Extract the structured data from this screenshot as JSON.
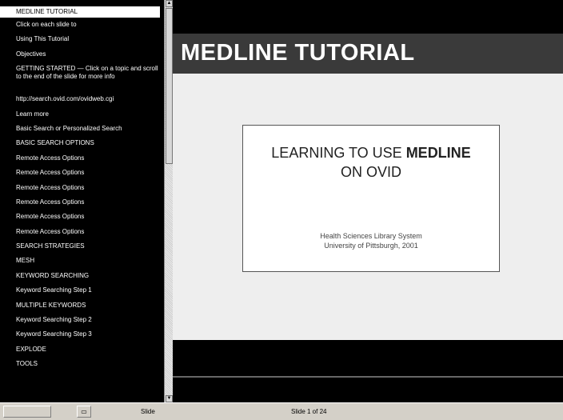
{
  "outline": {
    "items": [
      {
        "label": "MEDLINE TUTORIAL",
        "selected": true
      },
      {
        "label": "Click on each slide to"
      },
      {
        "label": "Using This Tutorial"
      },
      {
        "label": "Objectives"
      },
      {
        "label": "GETTING STARTED — Click on a topic and scroll to the end of the slide for more info",
        "multi": true
      },
      {
        "label": "http://search.ovid.com/ovidweb.cgi"
      },
      {
        "label": "Learn more"
      },
      {
        "label": "Basic Search or Personalized Search"
      },
      {
        "label": "BASIC SEARCH OPTIONS"
      },
      {
        "label": "Remote Access Options"
      },
      {
        "label": "Remote Access Options"
      },
      {
        "label": "Remote Access Options"
      },
      {
        "label": "Remote Access Options"
      },
      {
        "label": "Remote Access Options"
      },
      {
        "label": "Remote Access Options"
      },
      {
        "label": "SEARCH STRATEGIES"
      },
      {
        "label": "MESH"
      },
      {
        "label": "KEYWORD SEARCHING"
      },
      {
        "label": "Keyword Searching Step 1"
      },
      {
        "label": "MULTIPLE KEYWORDS"
      },
      {
        "label": "Keyword Searching Step 2"
      },
      {
        "label": "Keyword Searching Step 3"
      },
      {
        "label": "EXPLODE"
      },
      {
        "label": "TOOLS"
      }
    ]
  },
  "slide": {
    "title": "MEDLINE TUTORIAL",
    "heading_prefix": "LEARNING TO USE ",
    "heading_bold": "MEDLINE",
    "heading_line2": "ON OVID",
    "sub_line1": "Health Sciences Library System",
    "sub_line2": "University of Pittsburgh, 2001"
  },
  "statusbar": {
    "left_btn": "",
    "outline_icon": "slide-icon",
    "mode_label": "Slide",
    "center_text": "Slide 1 of 24"
  }
}
